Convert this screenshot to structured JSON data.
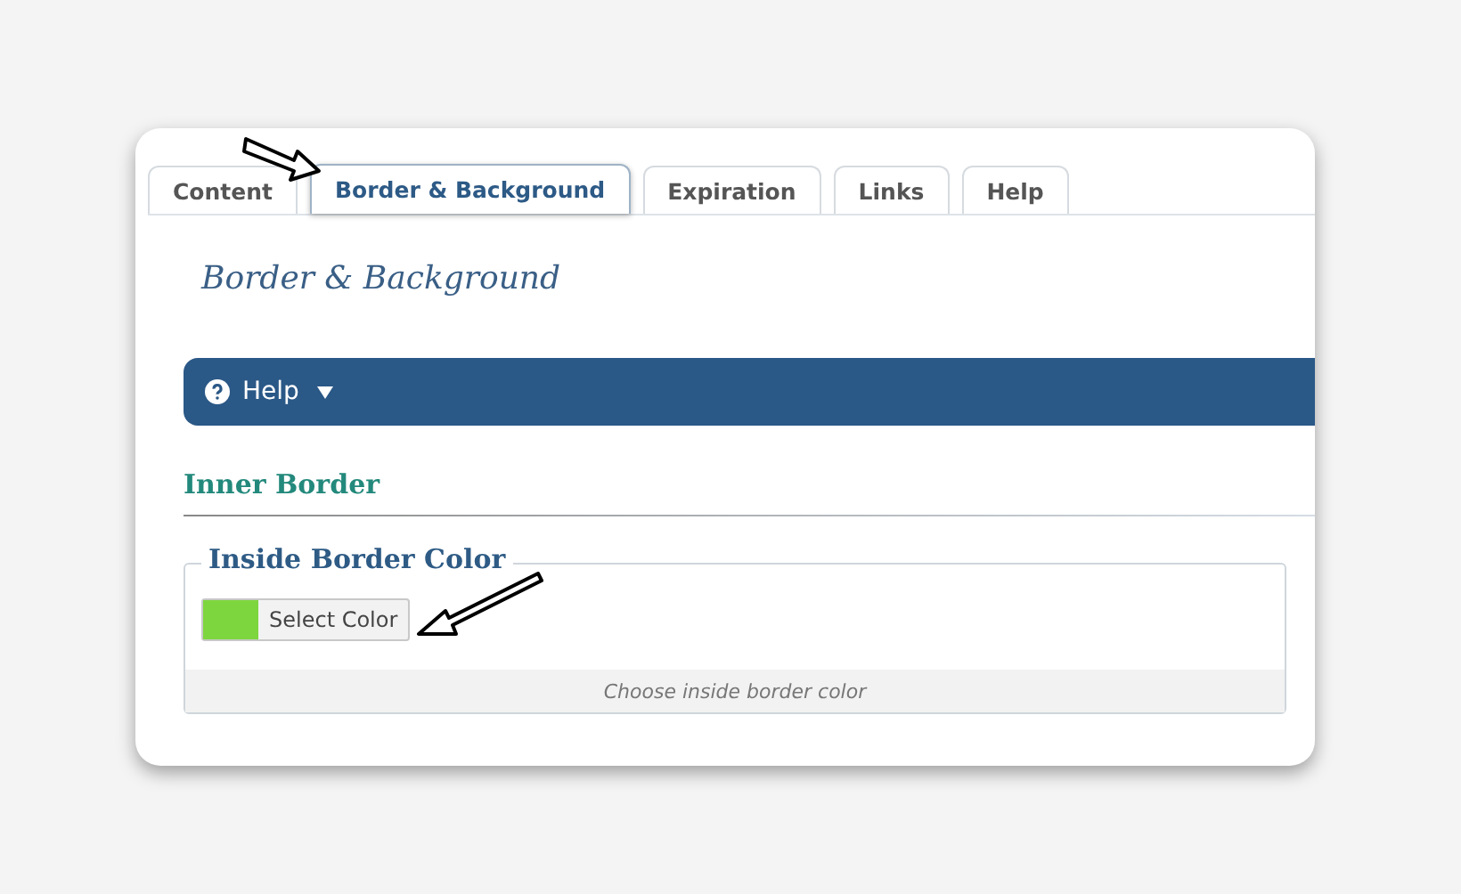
{
  "tabs": [
    {
      "label": "Content",
      "selected": false
    },
    {
      "label": "Border & Background",
      "selected": true
    },
    {
      "label": "Expiration",
      "selected": false
    },
    {
      "label": "Links",
      "selected": false
    },
    {
      "label": "Help",
      "selected": false
    }
  ],
  "page_title": "Border & Background",
  "help_bar": {
    "label": "Help",
    "expanded": false
  },
  "section": {
    "title": "Inner Border",
    "field": {
      "legend": "Inside Border Color",
      "button": "Select Color",
      "color": "#7ed63e",
      "hint": "Choose inside border color"
    }
  }
}
